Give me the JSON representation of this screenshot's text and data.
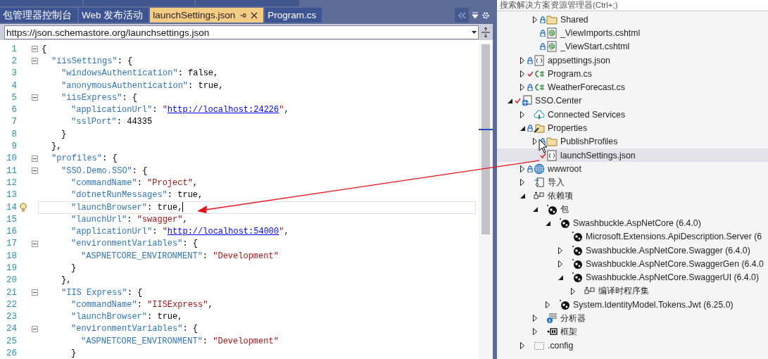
{
  "document_tabs": [
    {
      "label": "包管理器控制台",
      "selected": false
    },
    {
      "label": "Web 发布活动",
      "selected": false
    },
    {
      "label": "launchSettings.json",
      "selected": true
    },
    {
      "label": "Program.cs",
      "selected": false
    }
  ],
  "schema_bar": {
    "value": "https://json.schemastore.org/launchsettings.json"
  },
  "editor": {
    "lines": [
      {
        "number": "1",
        "fold": true,
        "current": false,
        "tokens": [
          {
            "kind": "plain",
            "text": "{"
          }
        ]
      },
      {
        "number": "2",
        "fold": true,
        "current": false,
        "tokens": [
          {
            "kind": "key",
            "text": "\"iisSettings\""
          },
          {
            "kind": "plain",
            "text": ": {"
          }
        ]
      },
      {
        "number": "3",
        "fold": false,
        "current": false,
        "tokens": [
          {
            "kind": "key",
            "text": "\"windowsAuthentication\""
          },
          {
            "kind": "plain",
            "text": ": false,"
          }
        ]
      },
      {
        "number": "4",
        "fold": false,
        "current": false,
        "tokens": [
          {
            "kind": "key",
            "text": "\"anonymousAuthentication\""
          },
          {
            "kind": "plain",
            "text": ": true,"
          }
        ]
      },
      {
        "number": "5",
        "fold": true,
        "current": false,
        "tokens": [
          {
            "kind": "key",
            "text": "\"iisExpress\""
          },
          {
            "kind": "plain",
            "text": ": {"
          }
        ]
      },
      {
        "number": "6",
        "fold": false,
        "current": false,
        "tokens": [
          {
            "kind": "key",
            "text": "\"applicationUrl\""
          },
          {
            "kind": "plain",
            "text": ": "
          },
          {
            "kind": "string",
            "text": "\""
          },
          {
            "kind": "link",
            "text": "http://localhost:24226"
          },
          {
            "kind": "string",
            "text": "\""
          },
          {
            "kind": "plain",
            "text": ","
          }
        ]
      },
      {
        "number": "7",
        "fold": false,
        "current": false,
        "tokens": [
          {
            "kind": "key",
            "text": "\"sslPort\""
          },
          {
            "kind": "plain",
            "text": ": 44335"
          }
        ]
      },
      {
        "number": "8",
        "fold": false,
        "current": false,
        "tokens": [
          {
            "kind": "plain",
            "text": "}"
          }
        ]
      },
      {
        "number": "9",
        "fold": false,
        "current": false,
        "tokens": [
          {
            "kind": "plain",
            "text": "},"
          }
        ]
      },
      {
        "number": "10",
        "fold": true,
        "current": false,
        "tokens": [
          {
            "kind": "key",
            "text": "\"profiles\""
          },
          {
            "kind": "plain",
            "text": ": {"
          }
        ]
      },
      {
        "number": "11",
        "fold": true,
        "current": false,
        "tokens": [
          {
            "kind": "key",
            "text": "\"SSO.Demo.SSO\""
          },
          {
            "kind": "plain",
            "text": ": {"
          }
        ]
      },
      {
        "number": "12",
        "fold": false,
        "current": false,
        "tokens": [
          {
            "kind": "key",
            "text": "\"commandName\""
          },
          {
            "kind": "plain",
            "text": ": "
          },
          {
            "kind": "string",
            "text": "\"Project\""
          },
          {
            "kind": "plain",
            "text": ","
          }
        ]
      },
      {
        "number": "13",
        "fold": false,
        "current": false,
        "tokens": [
          {
            "kind": "key",
            "text": "\"dotnetRunMessages\""
          },
          {
            "kind": "plain",
            "text": ": true,"
          }
        ]
      },
      {
        "number": "14",
        "fold": false,
        "current": true,
        "tokens": [
          {
            "kind": "key",
            "text": "\"launchBrowser\""
          },
          {
            "kind": "plain",
            "text": ": true,"
          }
        ]
      },
      {
        "number": "15",
        "fold": false,
        "current": false,
        "tokens": [
          {
            "kind": "key",
            "text": "\"launchUrl\""
          },
          {
            "kind": "plain",
            "text": ": "
          },
          {
            "kind": "string",
            "text": "\"swagger\""
          },
          {
            "kind": "plain",
            "text": ","
          }
        ]
      },
      {
        "number": "16",
        "fold": false,
        "current": false,
        "tokens": [
          {
            "kind": "key",
            "text": "\"applicationUrl\""
          },
          {
            "kind": "plain",
            "text": ": "
          },
          {
            "kind": "string",
            "text": "\""
          },
          {
            "kind": "link",
            "text": "http://localhost:54000"
          },
          {
            "kind": "string",
            "text": "\""
          },
          {
            "kind": "plain",
            "text": ","
          }
        ]
      },
      {
        "number": "17",
        "fold": true,
        "current": false,
        "tokens": [
          {
            "kind": "key",
            "text": "\"environmentVariables\""
          },
          {
            "kind": "plain",
            "text": ": {"
          }
        ]
      },
      {
        "number": "18",
        "fold": false,
        "current": false,
        "tokens": [
          {
            "kind": "key",
            "text": "\"ASPNETCORE_ENVIRONMENT\""
          },
          {
            "kind": "plain",
            "text": ": "
          },
          {
            "kind": "string",
            "text": "\"Development\""
          }
        ]
      },
      {
        "number": "19",
        "fold": false,
        "current": false,
        "tokens": [
          {
            "kind": "plain",
            "text": "}"
          }
        ]
      },
      {
        "number": "20",
        "fold": false,
        "current": false,
        "tokens": [
          {
            "kind": "plain",
            "text": "},"
          }
        ]
      },
      {
        "number": "21",
        "fold": true,
        "current": false,
        "tokens": [
          {
            "kind": "key",
            "text": "\"IIS Express\""
          },
          {
            "kind": "plain",
            "text": ": {"
          }
        ]
      },
      {
        "number": "22",
        "fold": false,
        "current": false,
        "tokens": [
          {
            "kind": "key",
            "text": "\"commandName\""
          },
          {
            "kind": "plain",
            "text": ": "
          },
          {
            "kind": "string",
            "text": "\"IISExpress\""
          },
          {
            "kind": "plain",
            "text": ","
          }
        ]
      },
      {
        "number": "23",
        "fold": false,
        "current": false,
        "tokens": [
          {
            "kind": "key",
            "text": "\"launchBrowser\""
          },
          {
            "kind": "plain",
            "text": ": true,"
          }
        ]
      },
      {
        "number": "24",
        "fold": true,
        "current": false,
        "tokens": [
          {
            "kind": "key",
            "text": "\"environmentVariables\""
          },
          {
            "kind": "plain",
            "text": ": {"
          }
        ]
      },
      {
        "number": "25",
        "fold": false,
        "current": false,
        "tokens": [
          {
            "kind": "key",
            "text": "\"ASPNETCORE_ENVIRONMENT\""
          },
          {
            "kind": "plain",
            "text": ": "
          },
          {
            "kind": "string",
            "text": "\"Development\""
          }
        ]
      },
      {
        "number": "26",
        "fold": false,
        "current": false,
        "tokens": [
          {
            "kind": "plain",
            "text": "}"
          }
        ]
      }
    ]
  },
  "solution_explorer": {
    "search": {
      "placeholder": "搜索解决方案资源管理器(Ctrl+;)"
    },
    "items": [
      {
        "children": [
          {
            "children": [
              {
                "label": "Shared",
                "kind": "folder",
                "pending_edit": false,
                "expanded": false,
                "selected": false
              },
              {
                "label": "_ViewImports.cshtml",
                "kind": "razor",
                "pending_edit": false,
                "selected": false
              },
              {
                "label": "_ViewStart.cshtml",
                "kind": "razor",
                "pending_edit": false,
                "selected": false
              }
            ]
          },
          {
            "label": "appsettings.json",
            "kind": "json",
            "pending_edit": false,
            "expanded": false,
            "selected": false
          },
          {
            "label": "Program.cs",
            "kind": "csharp",
            "pending_edit": true,
            "expanded": false,
            "selected": false
          },
          {
            "label": "WeatherForecast.cs",
            "kind": "csharp",
            "pending_edit": false,
            "expanded": false,
            "selected": false
          }
        ]
      },
      {
        "label": "SSO.Center",
        "kind": "project",
        "pending_edit": true,
        "expanded": true,
        "selected": false,
        "children": [
          {
            "label": "Connected Services",
            "kind": "cloud",
            "expanded": false,
            "selected": false
          },
          {
            "label": "Properties",
            "kind": "properties",
            "pending_edit": false,
            "expanded": true,
            "selected": false,
            "children": [
              {
                "label": "PublishProfiles",
                "kind": "folder",
                "pending_edit": false,
                "expanded": false,
                "selected": false
              },
              {
                "label": "launchSettings.json",
                "kind": "json",
                "pending_edit": true,
                "selected": true
              }
            ]
          },
          {
            "label": "wwwroot",
            "kind": "globe",
            "pending_edit": false,
            "expanded": false,
            "selected": false
          },
          {
            "label": "导入",
            "kind": "import",
            "expanded": false,
            "selected": false
          },
          {
            "label": "依赖项",
            "kind": "deps",
            "expanded": true,
            "selected": false,
            "children": [
              {
                "label": "包",
                "kind": "package",
                "expanded": true,
                "selected": false,
                "children": [
                  {
                    "label": "Swashbuckle.AspNetCore (6.4.0)",
                    "kind": "package",
                    "expanded": true,
                    "selected": false,
                    "children": [
                      {
                        "label": "Microsoft.Extensions.ApiDescription.Server (6",
                        "kind": "package",
                        "selected": false
                      },
                      {
                        "label": "Swashbuckle.AspNetCore.Swagger (6.4.0)",
                        "kind": "package",
                        "expanded": false,
                        "selected": false
                      },
                      {
                        "label": "Swashbuckle.AspNetCore.SwaggerGen (6.4.0",
                        "kind": "package",
                        "expanded": false,
                        "selected": false
                      },
                      {
                        "label": "Swashbuckle.AspNetCore.SwaggerUI (6.4.0)",
                        "kind": "package",
                        "expanded": true,
                        "selected": false,
                        "children": [
                          {
                            "label": "编译时程序集",
                            "kind": "deps",
                            "expanded": false,
                            "selected": false
                          }
                        ]
                      }
                    ]
                  },
                  {
                    "label": "System.IdentityModel.Tokens.Jwt (6.25.0)",
                    "kind": "package",
                    "expanded": false,
                    "selected": false
                  }
                ]
              },
              {
                "label": "分析器",
                "kind": "analyzer",
                "expanded": false,
                "selected": false
              },
              {
                "label": "框架",
                "kind": "framework",
                "expanded": false,
                "selected": false
              }
            ]
          },
          {
            "label": ".config",
            "kind": "config",
            "expanded": false,
            "selected": false
          }
        ]
      }
    ]
  }
}
